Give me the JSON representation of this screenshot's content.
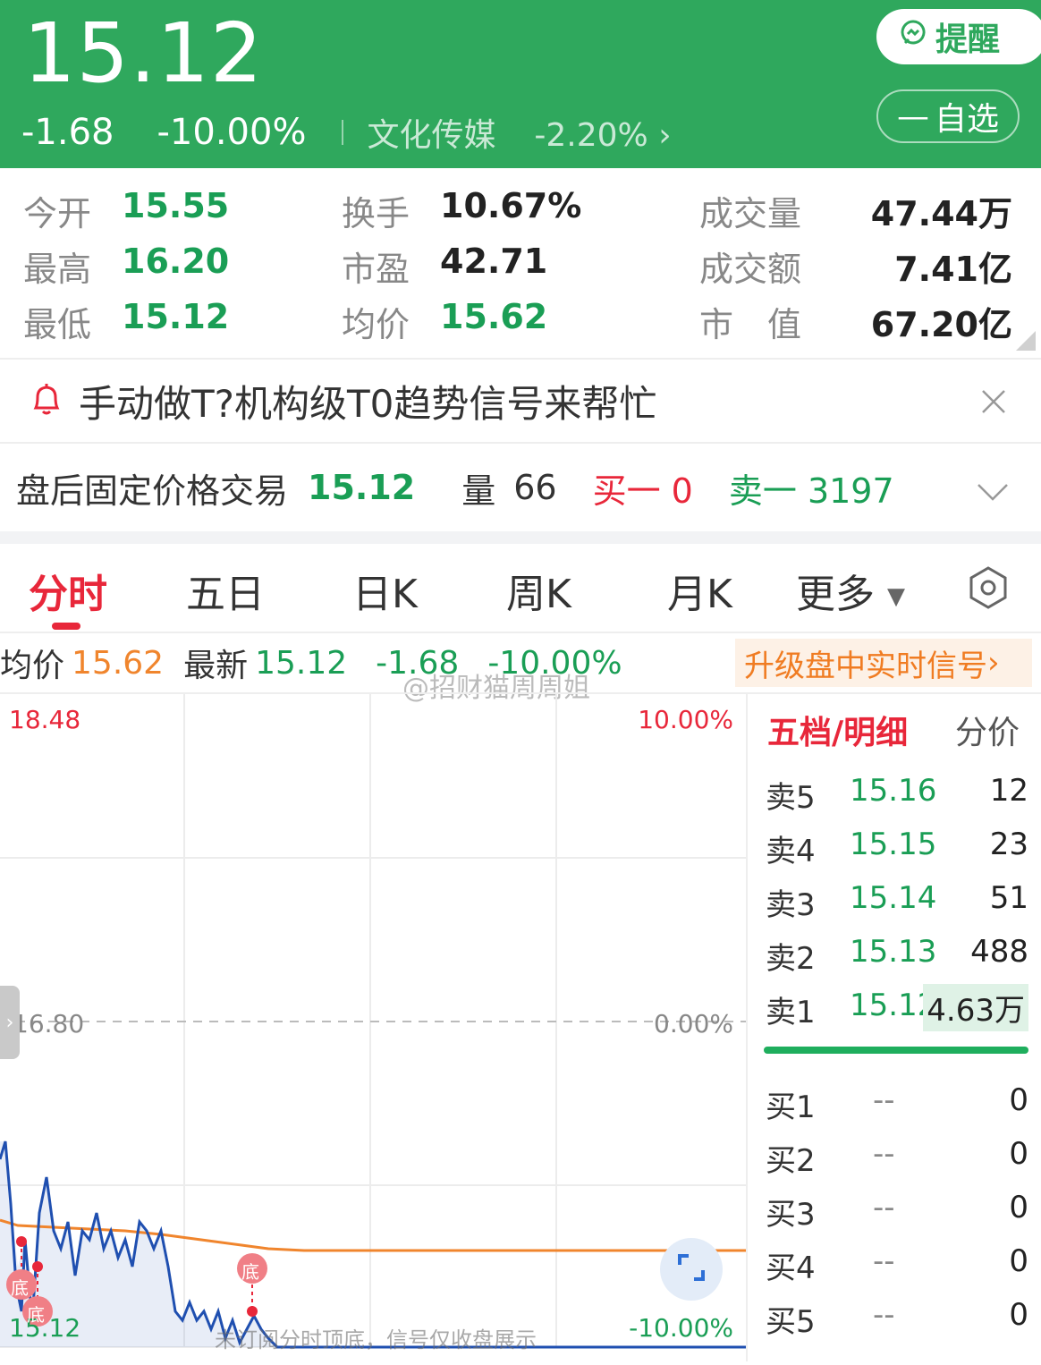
{
  "header": {
    "price": "15.12",
    "change": "-1.68",
    "change_pct": "-10.00%",
    "sector": "文化传媒",
    "sector_pct": "-2.20%",
    "remind_label": "提醒",
    "watch_label": "自选"
  },
  "stats": [
    {
      "label": "今开",
      "value": "15.55",
      "color": "green"
    },
    {
      "label": "最高",
      "value": "16.20",
      "color": "green"
    },
    {
      "label": "最低",
      "value": "15.12",
      "color": "green"
    },
    {
      "label": "换手",
      "value": "10.67%",
      "color": "dark"
    },
    {
      "label": "市盈",
      "value": "42.71",
      "color": "dark"
    },
    {
      "label": "均价",
      "value": "15.62",
      "color": "green"
    },
    {
      "label": "成交量",
      "value": "47.44万",
      "color": "dark"
    },
    {
      "label": "成交额",
      "value": "7.41亿",
      "color": "dark"
    },
    {
      "label": "市　值",
      "value": "67.20亿",
      "color": "dark"
    }
  ],
  "alert": {
    "text": "手动做T?机构级T0趋势信号来帮忙"
  },
  "after_hours": {
    "label": "盘后固定价格交易",
    "price": "15.12",
    "vol_label": "量",
    "vol": "66",
    "buy1": "买一 0",
    "sell1": "卖一 3197"
  },
  "tabs": [
    "分时",
    "五日",
    "日K",
    "周K",
    "月K",
    "更多"
  ],
  "info": {
    "avg_label": "均价",
    "avg": "15.62",
    "last_label": "最新",
    "last": "15.12",
    "chg": "-1.68",
    "pct": "-10.00%",
    "upgrade": "升级盘中实时信号",
    "watermark": "@招财猫周周姐"
  },
  "chart": {
    "top_price": "18.48",
    "top_pct": "10.00%",
    "mid_price": "16.80",
    "mid_pct": "0.00%",
    "bottom_price": "15.12",
    "bottom_pct": "-10.00%",
    "bottom_marker": "底",
    "note": "未订阅分时顶底，信号仅收盘展示",
    "colors": {
      "price_line": "#1f4fb0",
      "avg_line": "#f0852d"
    }
  },
  "book": {
    "title": "五档/明细",
    "alt": "分价",
    "sells": [
      {
        "level": "卖5",
        "price": "15.16",
        "vol": "12"
      },
      {
        "level": "卖4",
        "price": "15.15",
        "vol": "23"
      },
      {
        "level": "卖3",
        "price": "15.14",
        "vol": "51"
      },
      {
        "level": "卖2",
        "price": "15.13",
        "vol": "488"
      },
      {
        "level": "卖1",
        "price": "15.12",
        "vol": "4.63万"
      }
    ],
    "buys": [
      {
        "level": "买1",
        "price": "--",
        "vol": "0"
      },
      {
        "level": "买2",
        "price": "--",
        "vol": "0"
      },
      {
        "level": "买3",
        "price": "--",
        "vol": "0"
      },
      {
        "level": "买4",
        "price": "--",
        "vol": "0"
      },
      {
        "level": "买5",
        "price": "--",
        "vol": "0"
      }
    ]
  }
}
